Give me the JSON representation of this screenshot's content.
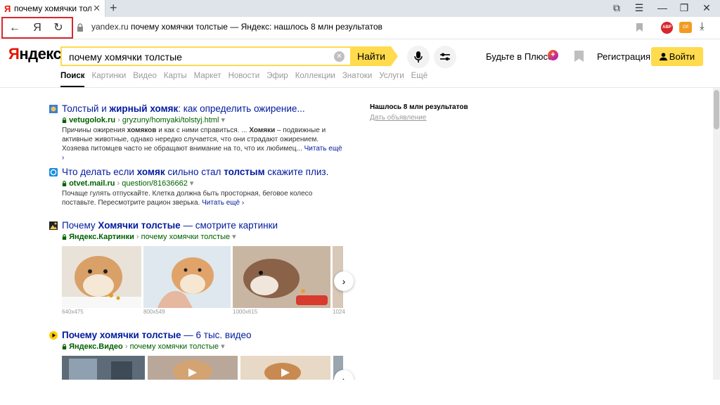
{
  "browser": {
    "tab_title": "почему хомячки толсте",
    "tab_close": "✕",
    "new_tab": "+",
    "nav": {
      "back": "←",
      "home": "Я",
      "reload": "↻"
    },
    "url_domain": "yandex.ru",
    "url_title": "почему хомячки толстые — Яндекс: нашлось 8 млн результатов",
    "ext_abp": "ABP",
    "ext_other": "Off",
    "download": "⤓",
    "window": {
      "bookmarks": "⧉",
      "menu": "☰",
      "minimize": "—",
      "restore": "❐",
      "close": "✕"
    }
  },
  "header": {
    "logo_first": "Я",
    "logo_rest": "ндекс",
    "query": "почему хомячки толстые",
    "clear": "✕",
    "find": "Найти",
    "mic": "🎤",
    "filters": "⚟",
    "plus_link": "Будьте в Плюсе",
    "plus_badge": "+",
    "register": "Регистрация",
    "login": "Войти",
    "login_icon": "👤"
  },
  "services": [
    "Поиск",
    "Картинки",
    "Видео",
    "Карты",
    "Маркет",
    "Новости",
    "Эфир",
    "Коллекции",
    "Знатоки",
    "Услуги",
    "Ещё"
  ],
  "results": [
    {
      "title_parts": [
        "Толстый и ",
        "жирный хомяк",
        ": как определить ожирение..."
      ],
      "domain": "vetugolok.ru",
      "path": "gryzuny/homyaki/tolstyj.html",
      "snippet": [
        "Причины ожирения ",
        "хомяков",
        " и как с ними справиться. ... ",
        "Хомяки",
        " – подвижные и активные животные, однако нередко случается, что они страдают ожирением. Хозяева питомцев часто не обращают внимание на то, что их любимец... "
      ],
      "more": "Читать ещё ›"
    },
    {
      "title_parts": [
        "Что делать если ",
        "хомяк",
        " сильно стал ",
        "толстым",
        " скажите плиз."
      ],
      "domain": "otvet.mail.ru",
      "path": "question/81636662",
      "snippet": [
        "Почаще гулять отпускайте. Клетка должна быть просторная, беговое колесо поставьте. Пересмотрите рацион зверька. "
      ],
      "more": "Читать ещё ›"
    },
    {
      "title_parts": [
        "Почему ",
        "Хомячки толстые",
        " — смотрите картинки"
      ],
      "domain": "Яндекс.Картинки",
      "path": "почему хомячки толстые"
    },
    {
      "title_parts": [
        "Почему хомячки толстые",
        " — 6 тыс. видео"
      ],
      "domain": "Яндекс.Видео",
      "path": "почему хомячки толстые"
    }
  ],
  "url_arrow": "›",
  "url_drop": "▾",
  "image_sizes": [
    "640x475",
    "800x549",
    "1000x615",
    "1024"
  ],
  "carousel_next": "›",
  "sidebar": {
    "count": "Нашлось 8 млн результатов",
    "ad": "Дать объявление"
  }
}
